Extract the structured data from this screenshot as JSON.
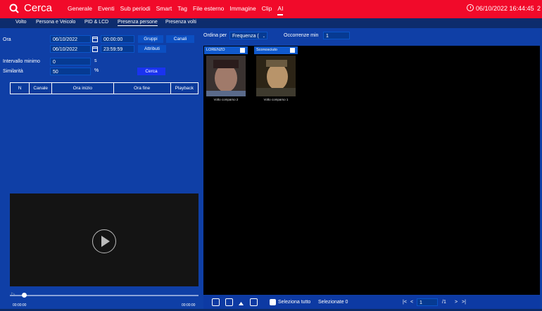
{
  "app": {
    "title": "Cerca"
  },
  "top_nav": [
    "Generale",
    "Eventi",
    "Sub periodi",
    "Smart",
    "Tag",
    "File esterno",
    "Immagine",
    "Clip",
    "AI"
  ],
  "top_nav_active_index": 8,
  "datetime": "06/10/2022 16:44:45",
  "corner_text": "2",
  "sub_tabs": [
    "Volto",
    "Persona e Veicolo",
    "PID & LCD",
    "Presenza persone",
    "Presenza volti"
  ],
  "sub_tabs_active_index": 3,
  "left": {
    "ora_label": "Ora",
    "start_date": "06/10/2022",
    "start_time": "00:00:00",
    "end_date": "06/10/2022",
    "end_time": "23:59:59",
    "gruppi_btn": "Gruppi",
    "canali_btn": "Canali",
    "attributi_btn": "Attributi",
    "intervallo_label": "Intervallo minimo",
    "intervallo_value": "0",
    "intervallo_unit": "s",
    "similarita_label": "Similarità",
    "similarita_value": "50",
    "similarita_unit": "%",
    "cerca_btn": "Cerca",
    "table_headers": [
      "N",
      "Canale",
      "Ora inizio",
      "Ora fine",
      "Playback"
    ],
    "time_start": "00:00:00",
    "time_end": "00:00:00"
  },
  "right": {
    "ordina_label": "Ordina per",
    "ordina_value": "Frequenza (",
    "occorrenze_label": "Occorrenze min",
    "occorrenze_value": "1",
    "cards": [
      {
        "name": "LORENZO",
        "caption": "Volto comparso 2"
      },
      {
        "name": "Sconosciuto",
        "caption": "Volto comparso 1"
      }
    ],
    "seleziona_tutto": "Seleziona tutto",
    "selezionate": "Selezionate 0",
    "page_value": "1",
    "page_total": "/1"
  },
  "colors": {
    "topbar": "#f10a2a",
    "panel": "#0f3fa6",
    "button": "#0b4fc2"
  }
}
